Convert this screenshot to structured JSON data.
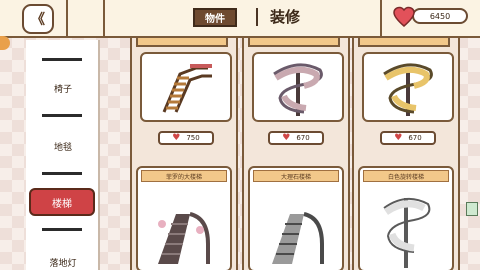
{
  "header": {
    "back_icon": "double-chevron-left-icon",
    "tab_items_label": "物件",
    "tab_decor_label": "装修",
    "currency_value": "6450",
    "currency_icon": "heart-icon"
  },
  "sidebar": {
    "items": [
      {
        "label": "椅子"
      },
      {
        "label": "地毯"
      },
      {
        "label": "楼梯"
      },
      {
        "label": "落地灯"
      }
    ]
  },
  "cards": [
    {
      "name": "",
      "price": "750"
    },
    {
      "name": "",
      "price": "670"
    },
    {
      "name": "",
      "price": "670"
    },
    {
      "name": "菲罗的大楼梯"
    },
    {
      "name": "大理石楼梯"
    },
    {
      "name": "白色旋转楼梯"
    }
  ],
  "colors": {
    "accent": "#cf4346",
    "brown": "#6e4a30",
    "card_label": "#f2c88a"
  }
}
